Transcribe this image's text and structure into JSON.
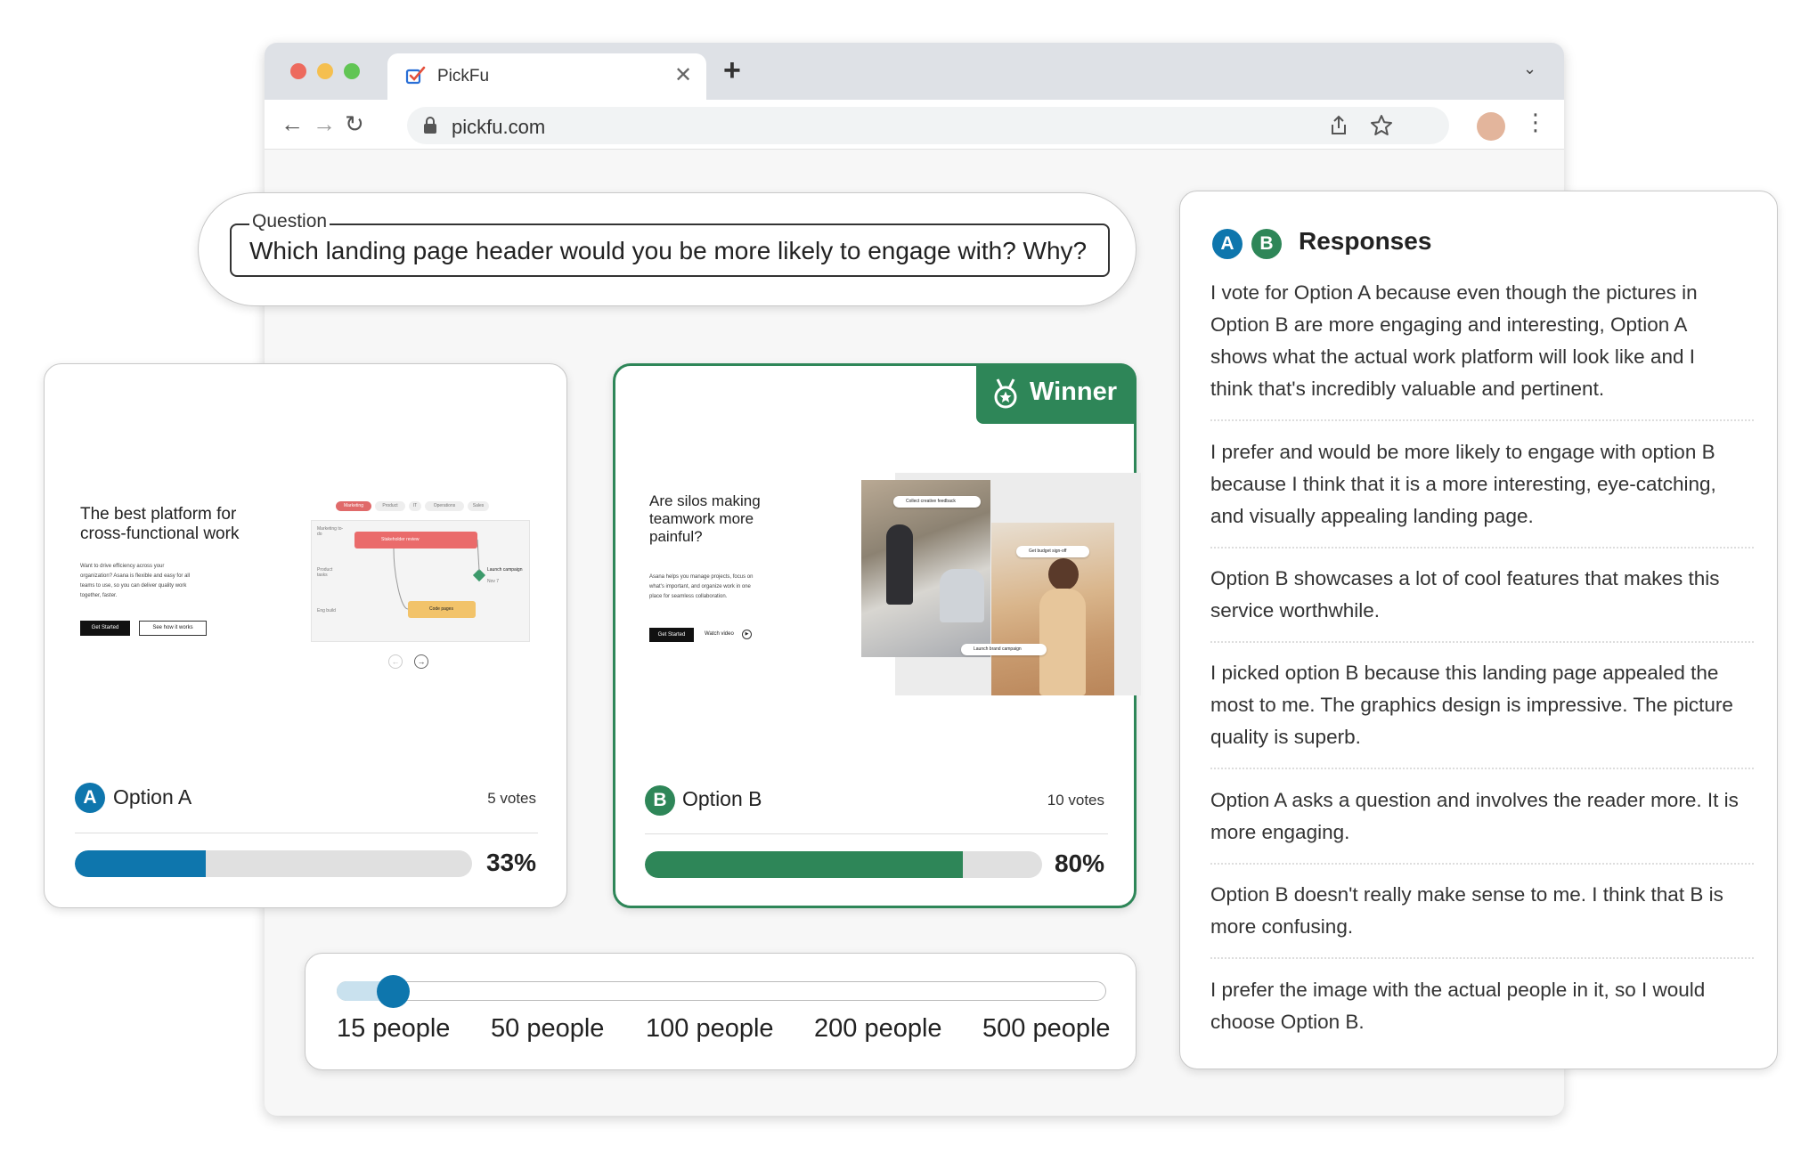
{
  "browser": {
    "tab_title": "PickFu",
    "url": "pickfu.com"
  },
  "question": {
    "label": "Question",
    "text": "Which landing page header would you be more likely to engage with? Why?"
  },
  "options": [
    {
      "letter": "A",
      "name": "Option A",
      "votes": "5 votes",
      "percent_label": "33%",
      "percent": 33,
      "color": "#0e76ad",
      "preview": {
        "headline_line1": "The best platform for",
        "headline_line2": "cross-functional work",
        "body": [
          "Want to drive efficiency across your",
          "organization? Asana is flexible and easy for all",
          "teams to use, so you can deliver quality work",
          "together, faster."
        ],
        "btn_primary": "Get Started",
        "btn_secondary": "See how it works",
        "tabs": [
          "Marketing",
          "Product",
          "IT",
          "Operations",
          "Sales"
        ],
        "rows": [
          "Marketing to-do",
          "Product tasks",
          "Eng build"
        ],
        "task1": "Stakeholder review",
        "task2": "Code pages",
        "milestone": "Launch campaign",
        "milestone_date": "Nov 7"
      }
    },
    {
      "letter": "B",
      "name": "Option B",
      "votes": "10 votes",
      "percent_label": "80%",
      "percent": 80,
      "color": "#2e8658",
      "winner_label": "Winner",
      "preview": {
        "headline_line1": "Are silos making",
        "headline_line2": "teamwork more",
        "headline_line3": "painful?",
        "body": [
          "Asana helps you manage projects, focus on",
          "what's important, and organize work in one",
          "place for seamless collaboration."
        ],
        "btn_primary": "Get Started",
        "btn_secondary": "Watch video",
        "chip1": "Collect creative feedback",
        "chip2": "Get budget sign-off",
        "chip3": "Launch brand campaign"
      }
    }
  ],
  "sample_size": {
    "options": [
      "15 people",
      "50 people",
      "100 people",
      "200 people",
      "500 people"
    ],
    "selected": "15 people"
  },
  "responses": {
    "title": "Responses",
    "badges": [
      "A",
      "B"
    ],
    "items": [
      [
        "I vote for Option A because even though the pictures in",
        "Option B are more engaging and interesting, Option A",
        "shows what the actual work platform will look like and I",
        "think that's incredibly valuable and pertinent."
      ],
      [
        "I prefer and would be more likely to engage with option B",
        "because I think that it is a more interesting, eye-catching,",
        "and visually appealing landing page."
      ],
      [
        "Option B showcases a lot of cool features that makes this",
        "service worthwhile."
      ],
      [
        "I picked option B because this landing page appealed the",
        "most to me. The graphics design is impressive. The picture",
        "quality is superb."
      ],
      [
        "Option A asks a question and involves the reader more. It is",
        "more engaging."
      ],
      [
        "Option B doesn't really make sense to me. I think that B is",
        "more confusing."
      ],
      [
        "I prefer the image with the actual people in it, so I would",
        "choose Option B."
      ]
    ]
  },
  "colors": {
    "option_a": "#0e76ad",
    "option_b": "#2e8658",
    "bar_track": "#e0e0e0"
  }
}
